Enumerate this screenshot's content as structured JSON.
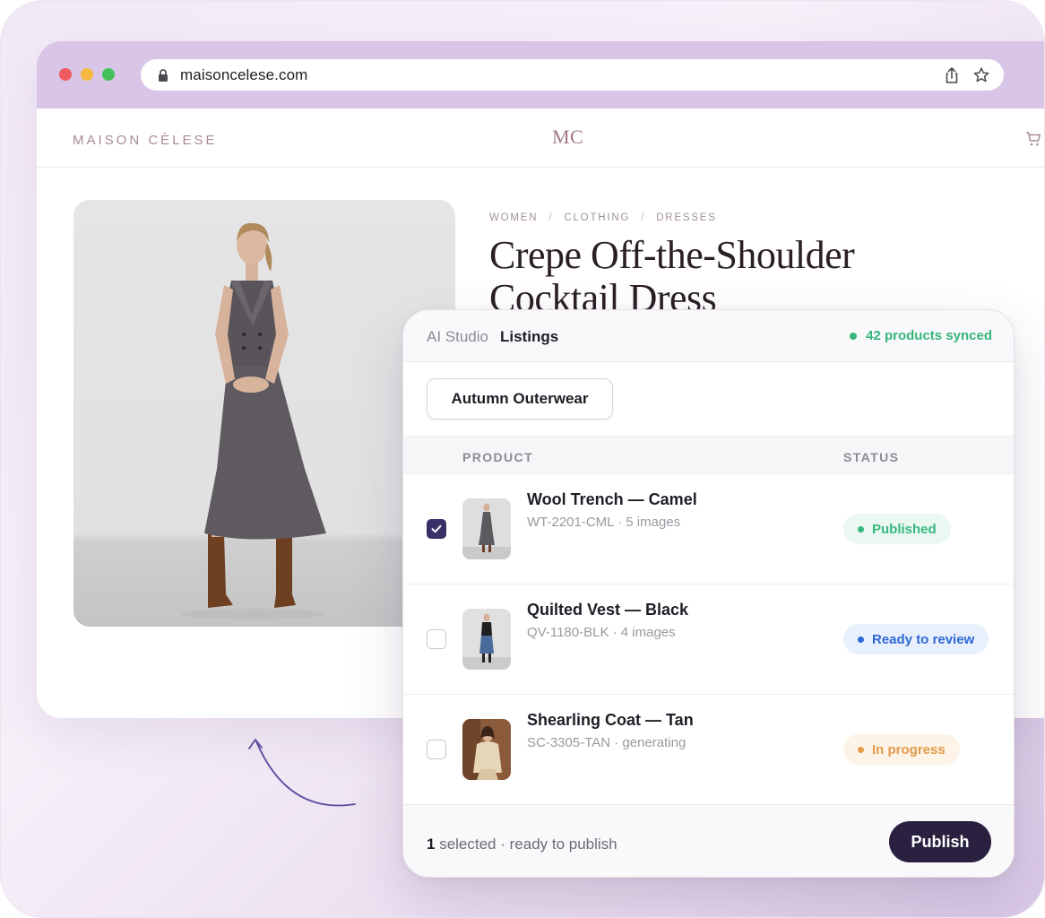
{
  "browser": {
    "url": "maisoncelese.com"
  },
  "site": {
    "brand": "MAISON CÈLESE",
    "monogram": "MC",
    "breadcrumb": [
      "WOMEN",
      "CLOTHING",
      "DRESSES"
    ],
    "breadcrumb_separator": "/",
    "product_title": "Crepe Off-the-Shoulder Cocktail Dress"
  },
  "panel": {
    "app_label": "AI Studio",
    "section_label": "Listings",
    "sync_status": "42 products synced",
    "collection": "Autumn Outerwear",
    "columns": {
      "product": "PRODUCT",
      "status": "STATUS"
    },
    "rows": [
      {
        "name": "Wool Trench — Camel",
        "meta": "WT-2201-CML · 5 images",
        "status": "Published",
        "checked": true
      },
      {
        "name": "Quilted Vest — Black",
        "meta": "QV-1180-BLK · 4 images",
        "status": "Ready to review",
        "checked": false
      },
      {
        "name": "Shearling Coat — Tan",
        "meta": "SC-3305-TAN · generating",
        "status": "In progress",
        "checked": false
      }
    ],
    "footer": {
      "selected_count": "1",
      "selected_text": " selected · ready to publish",
      "publish_label": "Publish"
    }
  },
  "colors": {
    "accent": "#2a2140",
    "published": "#37b67d",
    "review": "#2e68d6",
    "progress": "#e39a4b"
  }
}
